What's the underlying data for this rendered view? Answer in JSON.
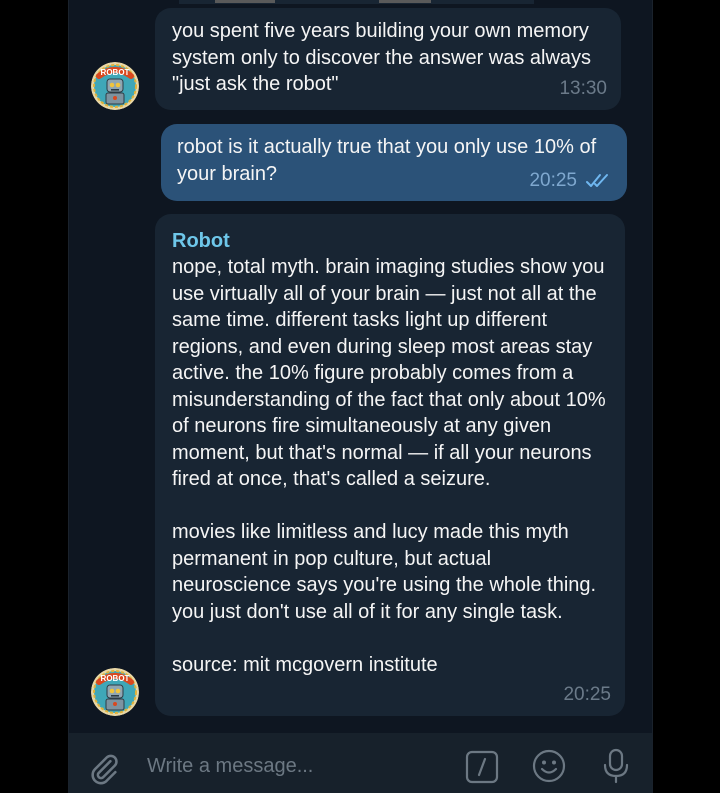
{
  "messages": [
    {
      "direction": "in",
      "text": "you spent five years building your own memory system only to discover the answer was always \"just ask the robot\"",
      "time": "13:30"
    },
    {
      "direction": "out",
      "text": "robot is it actually true that you only use 10% of your brain?",
      "time": "20:25",
      "status": "read"
    },
    {
      "direction": "in",
      "sender": "Robot",
      "text": "nope, total myth. brain imaging studies show you use virtually all of your brain — just not all at the same time. different tasks light up different regions, and even during sleep most areas stay active. the 10% figure probably comes from a misunderstanding of the fact that only about 10% of neurons fire simultaneously at any given moment, but that's normal — if all your neurons fired at once, that's called a seizure.\n\nmovies like limitless and lucy made this myth permanent in pop culture, but actual neuroscience says you're using the whole thing. you just don't use all of it for any single task.\n\nsource: mit mcgovern institute",
      "time": "20:25"
    }
  ],
  "avatar_label": "ROBOT",
  "composer": {
    "placeholder": "Write a message..."
  },
  "icons": {
    "attach": "paperclip-icon",
    "commands": "slash-command-icon",
    "emoji": "smiley-icon",
    "voice": "microphone-icon",
    "read_status": "double-check-icon"
  },
  "colors": {
    "background": "#0e1621",
    "incoming_bubble": "#182533",
    "outgoing_bubble": "#2b5278",
    "sender_name": "#6ec7ea",
    "read_ticks": "#6fb7f0"
  }
}
